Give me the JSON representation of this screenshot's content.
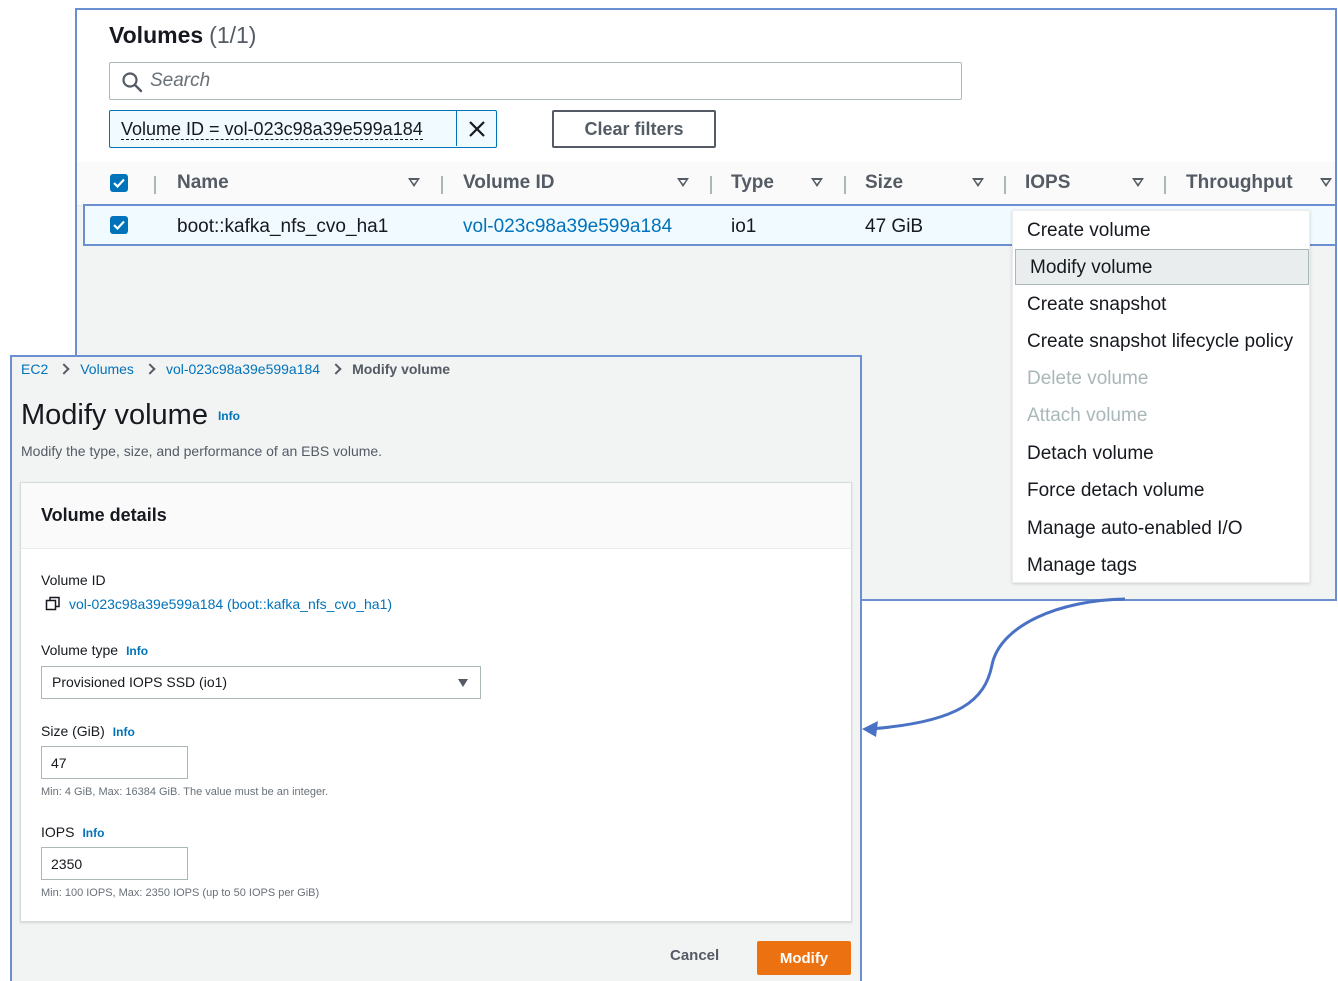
{
  "volumes_list": {
    "title": "Volumes",
    "count": "(1/1)",
    "search_placeholder": "Search",
    "filter_token": "Volume ID = vol-023c98a39e599a184",
    "clear_filters_label": "Clear filters",
    "columns": [
      "Name",
      "Volume ID",
      "Type",
      "Size",
      "IOPS",
      "Throughput"
    ],
    "row": {
      "name": "boot::kafka_nfs_cvo_ha1",
      "volume_id": "vol-023c98a39e599a184",
      "type": "io1",
      "size": "47 GiB"
    }
  },
  "actions_menu": {
    "items": [
      {
        "label": "Create volume",
        "state": "enabled"
      },
      {
        "label": "Modify volume",
        "state": "highlighted"
      },
      {
        "label": "Create snapshot",
        "state": "enabled"
      },
      {
        "label": "Create snapshot lifecycle policy",
        "state": "enabled"
      },
      {
        "label": "Delete volume",
        "state": "disabled"
      },
      {
        "label": "Attach volume",
        "state": "disabled"
      },
      {
        "label": "Detach volume",
        "state": "enabled"
      },
      {
        "label": "Force detach volume",
        "state": "enabled"
      },
      {
        "label": "Manage auto-enabled I/O",
        "state": "enabled"
      },
      {
        "label": "Manage tags",
        "state": "enabled"
      }
    ]
  },
  "modify_volume": {
    "breadcrumb": [
      "EC2",
      "Volumes",
      "vol-023c98a39e599a184",
      "Modify volume"
    ],
    "title": "Modify volume",
    "info_label": "Info",
    "description": "Modify the type, size, and performance of an EBS volume.",
    "card_title": "Volume details",
    "volume_id_label": "Volume ID",
    "volume_id_value": "vol-023c98a39e599a184 (boot::kafka_nfs_cvo_ha1)",
    "volume_type_label": "Volume type",
    "volume_type_value": "Provisioned IOPS SSD (io1)",
    "size_label": "Size (GiB)",
    "size_value": "47",
    "size_hint": "Min: 4 GiB, Max: 16384 GiB. The value must be an integer.",
    "iops_label": "IOPS",
    "iops_value": "2350",
    "iops_hint": "Min: 100 IOPS, Max: 2350 IOPS (up to 50 IOPS per GiB)",
    "cancel_label": "Cancel",
    "modify_label": "Modify"
  },
  "colors": {
    "accent_blue": "#0073bb",
    "primary_orange": "#ec7211",
    "panel_border": "#6c8fd1"
  }
}
